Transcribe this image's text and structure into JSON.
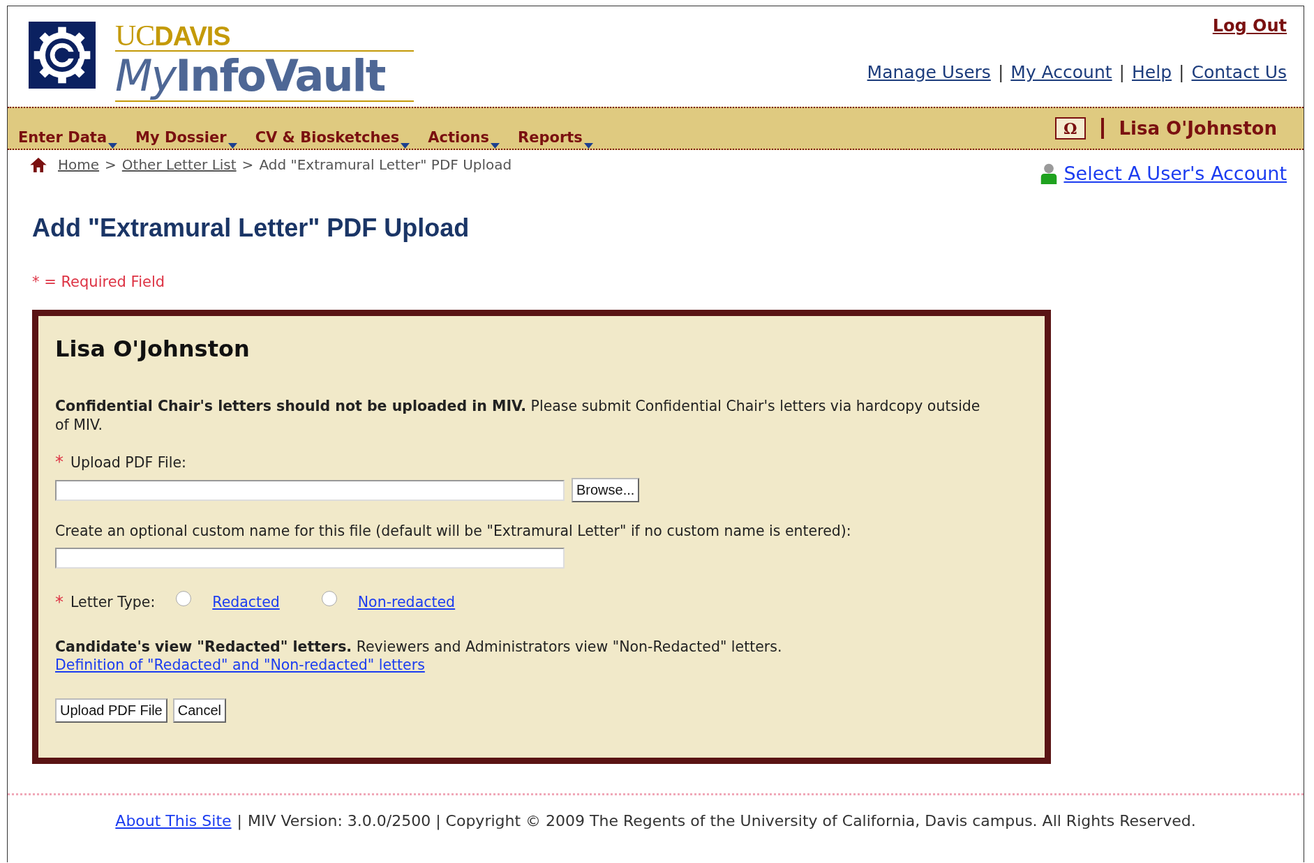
{
  "header": {
    "logo": {
      "uc": "UC",
      "davis": "DAVIS",
      "my": "My",
      "vault": "InfoVault"
    },
    "logout": "Log Out",
    "link_separator": "|",
    "links": [
      "Manage Users",
      "My Account",
      "Help",
      "Contact Us"
    ]
  },
  "nav": {
    "menus": [
      "Enter Data",
      "My Dossier",
      "CV & Biosketches",
      "Actions",
      "Reports"
    ],
    "symbol_button": "Ω",
    "user": "Lisa O'Johnston"
  },
  "breadcrumb": {
    "separator": ">",
    "items": [
      {
        "label": "Home",
        "link": true
      },
      {
        "label": "Other Letter List",
        "link": true
      },
      {
        "label": "Add \"Extramural Letter\" PDF Upload",
        "link": false
      }
    ]
  },
  "select_account": "Select A User's Account",
  "page_title": "Add \"Extramural Letter\" PDF Upload",
  "required_note": "* = Required Field",
  "panel": {
    "name": "Lisa O'Johnston",
    "notice": "**Confidential Chair's letters should not be uploaded in MIV.** Please submit Confidential Chair's letters via hardcopy outside of MIV.",
    "required_mark": "*",
    "fields": [
      {
        "kind": "file",
        "required": true,
        "label": "Upload PDF File:",
        "button": "Browse..."
      },
      {
        "kind": "text",
        "required": false,
        "label": "Create an optional custom name for this file (default will be \"Extramural Letter\" if no custom name is entered):"
      }
    ],
    "letter_type": {
      "label": "Letter Type:",
      "required": true,
      "options": [
        {
          "label": "Redacted",
          "selected": false
        },
        {
          "label": "Non-redacted",
          "selected": false
        }
      ]
    },
    "info": "**Candidate's view \"Redacted\" letters.** Reviewers and Administrators view \"Non-Redacted\" letters.",
    "definition_link": "Definition of \"Redacted\" and \"Non-redacted\" letters",
    "buttons": [
      "Upload PDF File",
      "Cancel"
    ]
  },
  "footer": {
    "about": "About This Site",
    "separator": "|",
    "text": "MIV Version: 3.0.0/2500 | Copyright © 2009 The Regents of the University of California, Davis campus. All Rights Reserved."
  }
}
